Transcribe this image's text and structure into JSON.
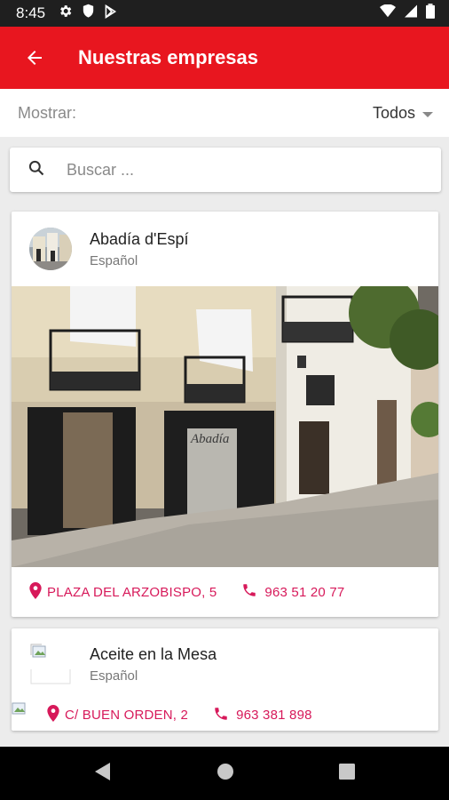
{
  "status_bar": {
    "time": "8:45",
    "left_icons": [
      "gear-icon",
      "shield-icon",
      "play-store-icon"
    ],
    "right_icons": [
      "wifi-icon",
      "signal-icon",
      "battery-icon"
    ]
  },
  "app_bar": {
    "title": "Nuestras empresas",
    "color": "#e8161f",
    "back_icon": "arrow-left-icon"
  },
  "filter": {
    "label": "Mostrar:",
    "selected": "Todos"
  },
  "search": {
    "placeholder": "Buscar ..."
  },
  "companies": [
    {
      "name": "Abadía d'Espí",
      "language": "Español",
      "address": "PLAZA DEL ARZOBISPO, 5",
      "phone": "963 51 20 77",
      "photo_sign": "Abadía"
    },
    {
      "name": "Aceite en la Mesa",
      "language": "Español",
      "address": "C/ BUEN ORDEN, 2",
      "phone": "963 381 898"
    }
  ],
  "colors": {
    "accent": "#e8161f",
    "link": "#d7195a"
  }
}
